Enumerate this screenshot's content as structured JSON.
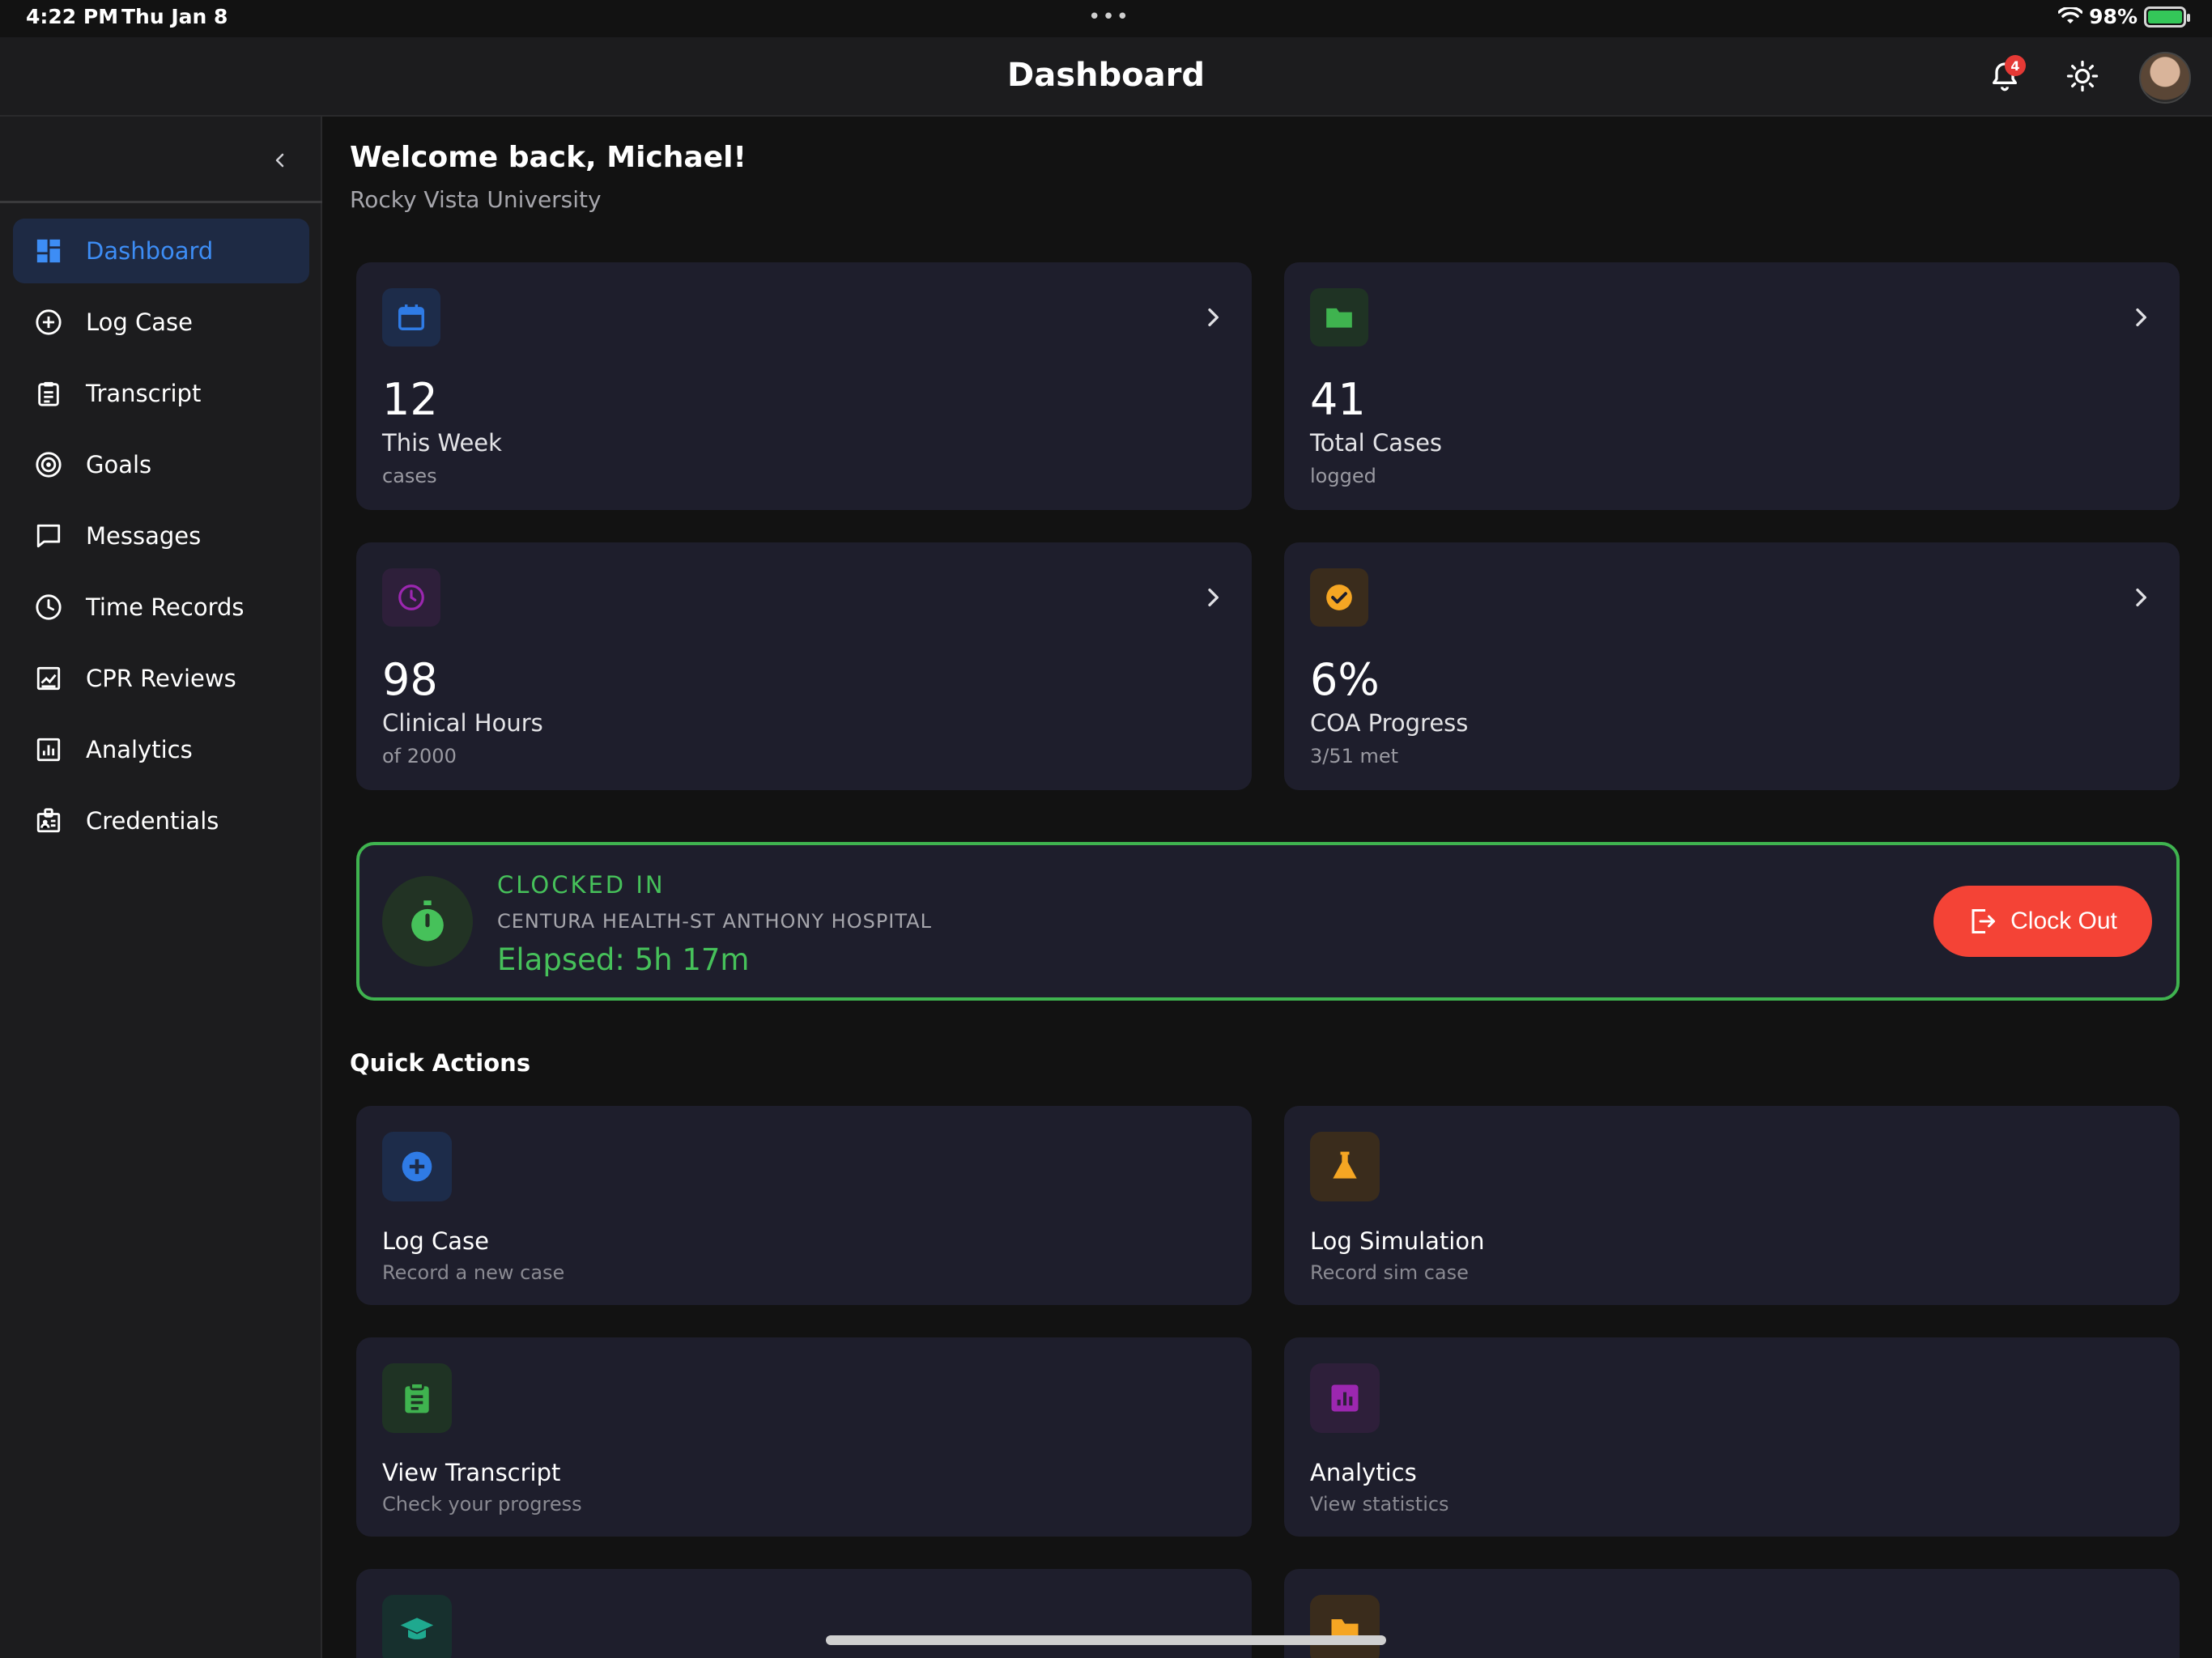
{
  "status_bar": {
    "time": "4:22 PM",
    "date": "Thu Jan 8",
    "dots": "•••",
    "battery": "98%"
  },
  "header": {
    "title": "Dashboard",
    "notification_count": "4"
  },
  "sidebar": {
    "items": [
      {
        "label": "Dashboard",
        "icon": "dashboard-icon"
      },
      {
        "label": "Log Case",
        "icon": "plus-circle-icon"
      },
      {
        "label": "Transcript",
        "icon": "clipboard-icon"
      },
      {
        "label": "Goals",
        "icon": "target-icon"
      },
      {
        "label": "Messages",
        "icon": "message-icon"
      },
      {
        "label": "Time Records",
        "icon": "clock-icon"
      },
      {
        "label": "CPR Reviews",
        "icon": "review-icon"
      },
      {
        "label": "Analytics",
        "icon": "analytics-icon"
      },
      {
        "label": "Credentials",
        "icon": "badge-icon"
      }
    ]
  },
  "welcome": {
    "greeting": "Welcome back, Michael!",
    "school": "Rocky Vista University"
  },
  "stats": [
    {
      "value": "12",
      "label": "This Week",
      "sub": "cases",
      "icon": "calendar-icon",
      "color": "#2f7be5"
    },
    {
      "value": "41",
      "label": "Total Cases",
      "sub": "logged",
      "icon": "folder-icon",
      "color": "#3fb34f"
    },
    {
      "value": "98",
      "label": "Clinical Hours",
      "sub": "of 2000",
      "icon": "clock-icon",
      "color": "#9c27b0"
    },
    {
      "value": "6%",
      "label": "COA Progress",
      "sub": "3/51 met",
      "icon": "check-circle-icon",
      "color": "#f5a623"
    }
  ],
  "clock": {
    "status": "CLOCKED IN",
    "site": "CENTURA HEALTH-ST ANTHONY HOSPITAL",
    "elapsed": "Elapsed: 5h 17m",
    "button_label": "Clock Out",
    "accent": "#46c15a",
    "button_color": "#f44336"
  },
  "quick_actions": {
    "title": "Quick Actions",
    "items": [
      {
        "label": "Log Case",
        "sub": "Record a new case",
        "icon": "plus-circle-icon",
        "color": "#2f7be5"
      },
      {
        "label": "Log Simulation",
        "sub": "Record sim case",
        "icon": "flask-icon",
        "color": "#f5a623"
      },
      {
        "label": "View Transcript",
        "sub": "Check your progress",
        "icon": "clipboard-icon",
        "color": "#3fb34f"
      },
      {
        "label": "Analytics",
        "sub": "View statistics",
        "icon": "analytics-icon",
        "color": "#9c27b0"
      }
    ]
  }
}
